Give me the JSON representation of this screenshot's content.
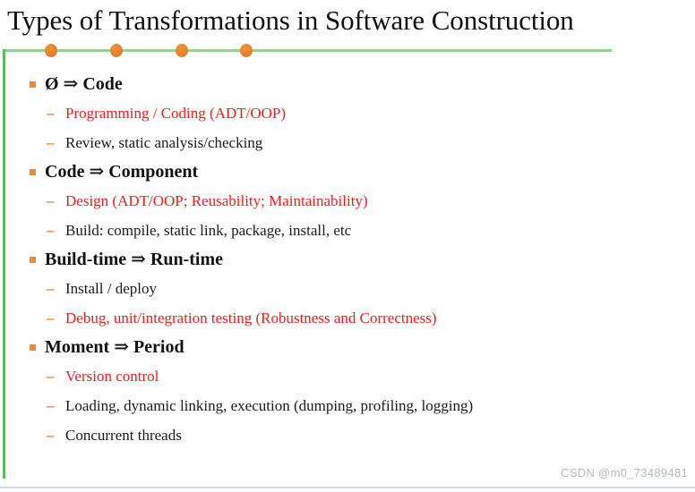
{
  "slide": {
    "title": "Types of Transformations in Software Construction",
    "accent_green": "#7ae47f",
    "accent_green_dark": "#35d53c",
    "accent_orange": "#e8822a",
    "bullet_orange": "#ed8b2d",
    "dash_orange": "#ec7a2a",
    "highlight_red": "#f01c1c",
    "body_black": "#1a1a1a",
    "dash_glyph": "–",
    "decor_dot_count": 4,
    "groups": [
      {
        "heading": "Ø ⇒ Code",
        "items": [
          {
            "text": "Programming / Coding (ADT/OOP)",
            "color": "red"
          },
          {
            "text": "Review, static analysis/checking",
            "color": "black"
          }
        ]
      },
      {
        "heading": "Code ⇒ Component",
        "items": [
          {
            "text": "Design (ADT/OOP; Reusability; Maintainability)",
            "color": "red"
          },
          {
            "text": "Build: compile, static link, package, install, etc",
            "color": "black"
          }
        ]
      },
      {
        "heading": "Build-time ⇒ Run-time",
        "items": [
          {
            "text": "Install / deploy",
            "color": "black"
          },
          {
            "text": "Debug, unit/integration testing (Robustness and Correctness)",
            "color": "red"
          }
        ]
      },
      {
        "heading": "Moment ⇒ Period",
        "items": [
          {
            "text": "Version control",
            "color": "red"
          },
          {
            "text": "Loading, dynamic linking, execution (dumping, profiling, logging)",
            "color": "black"
          },
          {
            "text": "Concurrent threads",
            "color": "black"
          }
        ]
      }
    ]
  },
  "watermark": {
    "text": "CSDN @m0_73489481"
  }
}
